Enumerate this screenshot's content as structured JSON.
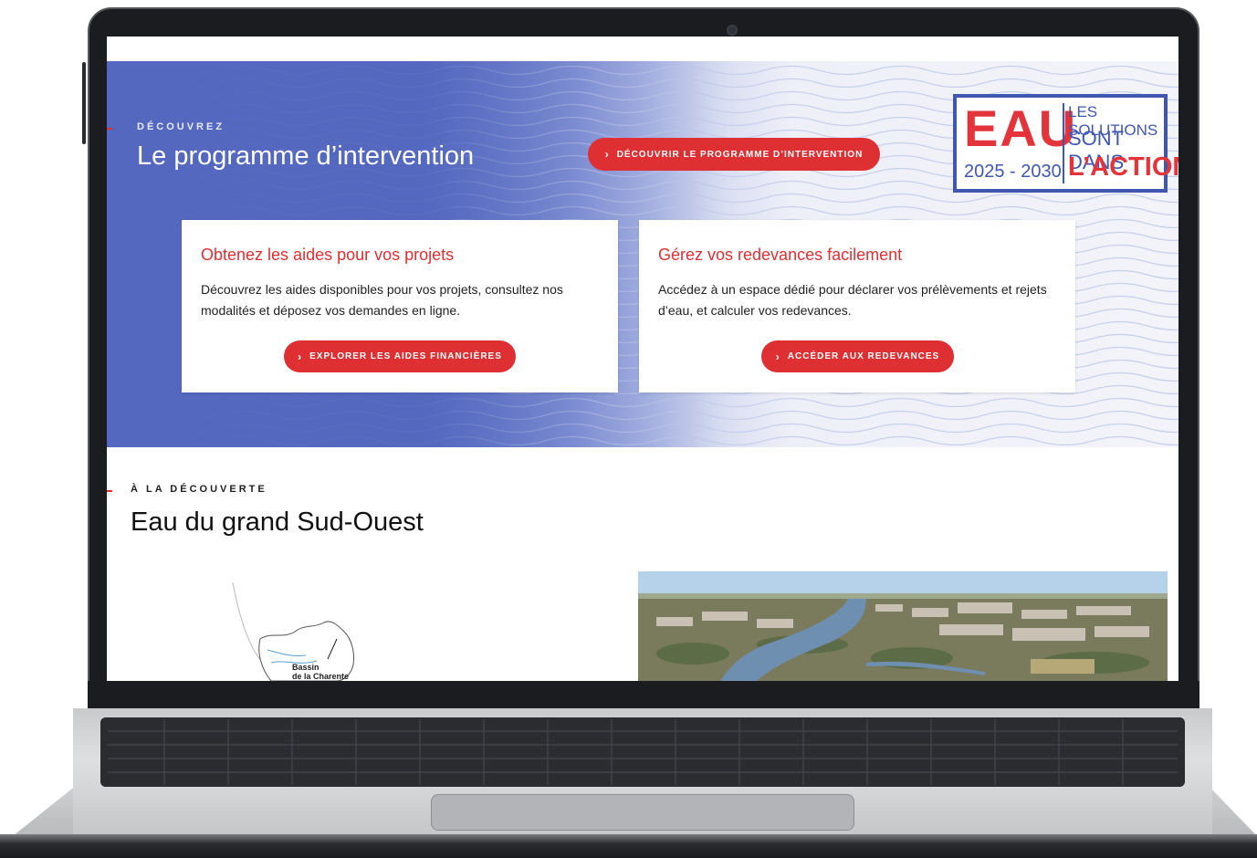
{
  "hero": {
    "eyebrow": "DÉCOUVREZ",
    "title": "Le programme d’intervention",
    "cta_label": "DÉCOUVRIR LE PROGRAMME D’INTERVENTION"
  },
  "logo": {
    "word": "EAU",
    "years": "2025 - 2030",
    "line1": "LES SOLUTIONS",
    "line2": "SONT DANS",
    "line3": "L’ACTION"
  },
  "cards": [
    {
      "title": "Obtenez les aides pour vos projets",
      "text": "Découvrez les aides disponibles pour vos projets, consultez nos modalités et déposez vos demandes en ligne.",
      "button": "EXPLORER LES AIDES FINANCIÈRES"
    },
    {
      "title": "Gérez vos redevances facilement",
      "text": "Accédez à un espace dédié pour déclarer vos prélèvements et rejets d’eau, et calculer vos redevances.",
      "button": "ACCÉDER AUX REDEVANCES"
    }
  ],
  "section": {
    "eyebrow": "À LA DÉCOUVERTE",
    "title": "Eau du grand Sud-Ouest",
    "map_label_1": "Bassin",
    "map_label_2": "de la Charente"
  },
  "icons": {
    "chevron": "chevron-right-icon"
  },
  "colors": {
    "accent_red": "#de2f33",
    "hero_blue": "#5468bf",
    "logo_blue": "#3f57b1"
  }
}
